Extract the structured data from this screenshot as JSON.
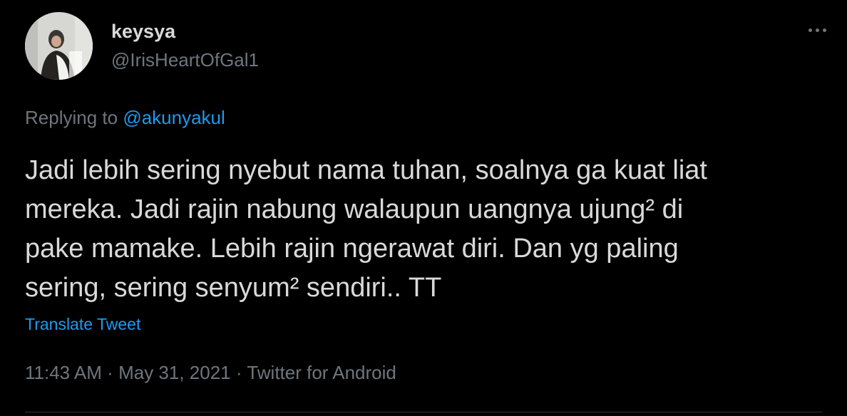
{
  "author": {
    "display_name": "keysya",
    "handle": "@IrisHeartOfGal1"
  },
  "reply": {
    "prefix": "Replying to",
    "mention": "@akunyakul"
  },
  "tweet": {
    "text": "Jadi lebih sering nyebut nama tuhan, soalnya ga kuat liat\nmereka. Jadi rajin nabung walaupun uangnya ujung² di\npake mamake. Lebih rajin ngerawat diri. Dan yg paling\nsering, sering senyum² sendiri.. TT",
    "translate_label": "Translate Tweet"
  },
  "meta": {
    "time": "11:43 AM",
    "date": "May 31, 2021",
    "source": "Twitter for Android",
    "separator": "·"
  },
  "icons": {
    "more": "more-horizontal-icon",
    "avatar": "profile-avatar"
  },
  "colors": {
    "background": "#000000",
    "text": "#d9d9d9",
    "secondary": "#6e767d",
    "accent": "#1d9bf0"
  }
}
